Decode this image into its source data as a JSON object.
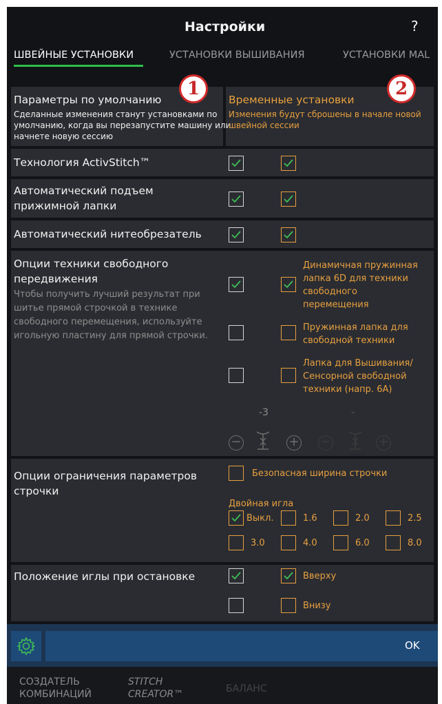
{
  "header": {
    "title": "Настройки",
    "help": "?"
  },
  "tabs": [
    "ШВЕЙНЫЕ УСТАНОВКИ",
    "УСТАНОВКИ ВЫШИВАНИЯ",
    "УСТАНОВКИ MAL"
  ],
  "columns": {
    "default_title": "Параметры по умолчанию",
    "default_desc_1": "Сделанные изменения станут установками по",
    "default_desc_2": "умолчанию, когда вы перезапустите машину или",
    "default_desc_3": "начнете новую сессию",
    "temp_title": "Временные установки",
    "temp_desc_1": "Изменения будут сброшены в начале новой",
    "temp_desc_2": "швейной сессии",
    "badge_1": "1",
    "badge_2": "2"
  },
  "rows": {
    "activstitch": "Технология ActivStitch™",
    "auto_lift_1": "Автоматический подъем",
    "auto_lift_2": "прижимной лапки",
    "thread_cutter": "Автоматический нитеобрезатель",
    "free_motion_1": "Опции техники свободного",
    "free_motion_2": "передвижения",
    "free_motion_hint_1": "Чтобы получить лучший результат при",
    "free_motion_hint_2": "шитье прямой строчкой в технике",
    "free_motion_hint_3": "свободного перемещения, используйте",
    "free_motion_hint_4": "игольную пластину для прямой строчки.",
    "fm_opt1_1": "Динамичная пружинная",
    "fm_opt1_2": "лапка 6D для техники",
    "fm_opt1_3": "свободного",
    "fm_opt1_4": "перемещения",
    "fm_opt2_1": "Пружинная лапка для",
    "fm_opt2_2": "свободной техники",
    "fm_opt3_1": "Лапка для Вышивания/",
    "fm_opt3_2": "Сенсорной свободной",
    "fm_opt3_3": "техники (напр. 6А)",
    "height_value": "-3",
    "height_value_temp": "-",
    "minus": "−",
    "plus": "+",
    "stitch_limit_1": "Опции ограничения параметров",
    "stitch_limit_2": "строчки",
    "safe_width": "Безопасная ширина строчки",
    "twin_needle": "Двойная игла",
    "twin_options": [
      "Выкл.",
      "1.6",
      "2.0",
      "2.5",
      "3.0",
      "4.0",
      "6.0",
      "8.0"
    ],
    "needle_stop": "Положение иглы при остановке",
    "needle_up": "Вверху",
    "needle_down": "Внизу"
  },
  "footer": {
    "ok": "OK",
    "tab1_1": "СОЗДАТЕЛЬ",
    "tab1_2": "КОМБИНАЦИЙ",
    "tab2_1": "STITCH",
    "tab2_2": "CREATOR™",
    "tab3": "БАЛАНС"
  },
  "colors": {
    "accent_orange": "#e8a040",
    "check_green": "#3fbf56",
    "active_tab_underline": "#2fbf4a",
    "ok_bar": "#1e4a78",
    "badge_red": "#d22a2a"
  }
}
